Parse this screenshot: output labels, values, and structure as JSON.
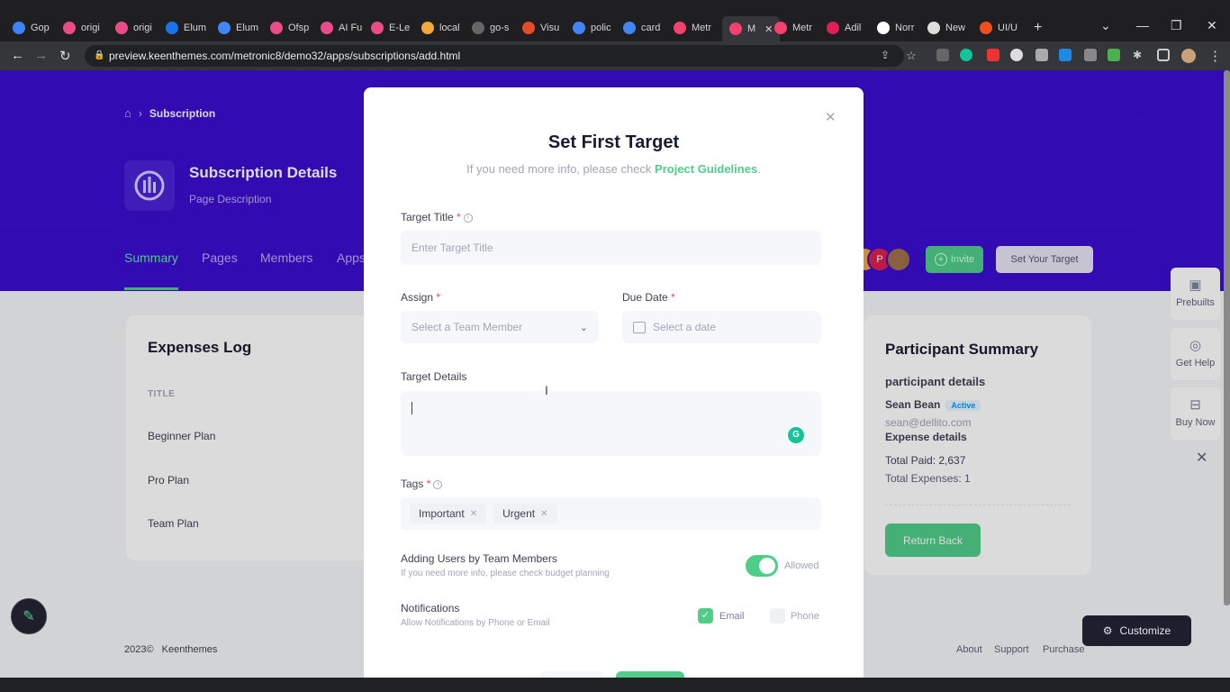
{
  "browser": {
    "tabs": [
      {
        "label": "Gop",
        "color": "#3b82f6"
      },
      {
        "label": "origi",
        "color": "#ea4c89"
      },
      {
        "label": "origi",
        "color": "#ea4c89"
      },
      {
        "label": "Elum",
        "color": "#1a73e8"
      },
      {
        "label": "Elum",
        "color": "#4285f4"
      },
      {
        "label": "Ofsp",
        "color": "#ea4c89"
      },
      {
        "label": "AI Fu",
        "color": "#ea4c89"
      },
      {
        "label": "E-Le",
        "color": "#ea4c89"
      },
      {
        "label": "local",
        "color": "#f2a93b"
      },
      {
        "label": "go-s",
        "color": "#666666"
      },
      {
        "label": "Visu",
        "color": "#e34c26"
      },
      {
        "label": "polic",
        "color": "#4285f4"
      },
      {
        "label": "card",
        "color": "#4285f4"
      },
      {
        "label": "Metr",
        "color": "#f1416c"
      },
      {
        "label": "M",
        "color": "#f1416c"
      },
      {
        "label": "Metr",
        "color": "#f1416c"
      },
      {
        "label": "Adil",
        "color": "#e01e5a"
      },
      {
        "label": "Norr",
        "color": "#ffffff"
      },
      {
        "label": "New",
        "color": "#dddddd"
      },
      {
        "label": "UI/U",
        "color": "#f24e1e"
      }
    ],
    "new_tab_label": "+",
    "url": "preview.keenthemes.com/metronic8/demo32/apps/subscriptions/add.html"
  },
  "breadcrumb": {
    "home_icon": "home-icon",
    "current": "Subscription"
  },
  "header": {
    "title": "Subscription Details",
    "description": "Page Description"
  },
  "nav_tabs": [
    "Summary",
    "Pages",
    "Members",
    "Apps"
  ],
  "toolbar": {
    "invite_label": "Invite",
    "avatar_letter": "P",
    "target_label": "Set Your Target"
  },
  "expenses": {
    "title": "Expenses Log",
    "column": "TITLE",
    "rows": [
      "Beginner Plan",
      "Pro Plan",
      "Team Plan"
    ]
  },
  "summary": {
    "title": "Participant Summary",
    "participant_heading": "participant details",
    "name": "Sean Bean",
    "status": "Active",
    "email": "sean@dellito.com",
    "expense_heading": "Expense details",
    "total_paid": "Total Paid: 2,637",
    "total_expenses": "Total Expenses: 1",
    "return_label": "Return Back"
  },
  "right_toolbar": [
    {
      "label": "Prebuilts",
      "icon": "layers-icon"
    },
    {
      "label": "Get Help",
      "icon": "lifebuoy-icon"
    },
    {
      "label": "Buy Now",
      "icon": "basket-icon"
    }
  ],
  "footer": {
    "copyright": "2023©",
    "brand": "Keenthemes",
    "links": [
      "About",
      "Support",
      "Purchase"
    ]
  },
  "customize_label": "Customize",
  "modal": {
    "title": "Set First Target",
    "subtitle_prefix": "If you need more info, please check ",
    "subtitle_link": "Project Guidelines",
    "subtitle_suffix": ".",
    "target_title_label": "Target Title",
    "target_title_placeholder": "Enter Target Title",
    "assign_label": "Assign",
    "assign_placeholder": "Select a Team Member",
    "due_label": "Due Date",
    "due_placeholder": "Select a date",
    "details_label": "Target Details",
    "tags_label": "Tags",
    "tags": [
      "Important",
      "Urgent"
    ],
    "adding_users_label": "Adding Users by Team Members",
    "adding_users_desc": "If you need more info, please check budget planning",
    "allowed_label": "Allowed",
    "allowed_checked": true,
    "notifications_label": "Notifications",
    "notifications_desc": "Allow Notifications by Phone or Email",
    "email_label": "Email",
    "email_checked": true,
    "phone_label": "Phone",
    "phone_checked": false
  }
}
